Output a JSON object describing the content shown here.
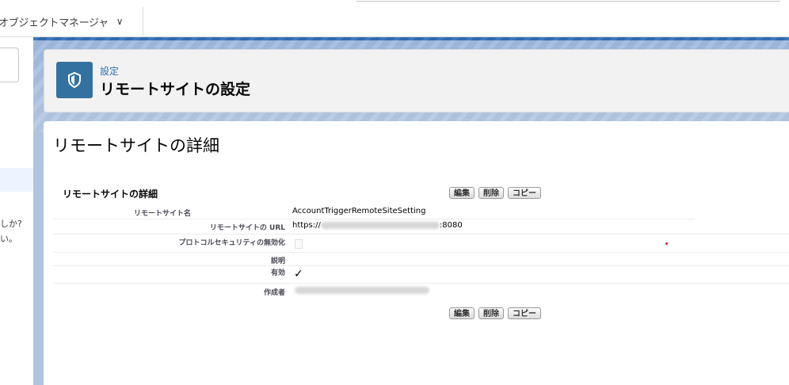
{
  "app": {
    "tab_label": "オブジェクトマネージャ",
    "chevron": "∨"
  },
  "left_panel": {
    "text1": "しか?",
    "text2": "い。"
  },
  "header": {
    "breadcrumb": "設定",
    "title": "リモートサイトの設定",
    "icon": "shield-icon"
  },
  "page": {
    "heading": "リモートサイトの詳細",
    "section_title": "リモートサイトの詳細"
  },
  "buttons": {
    "edit": "編集",
    "delete": "削除",
    "copy": "コピー"
  },
  "fields": {
    "name_label": "リモートサイト名",
    "name_value": "AccountTriggerRemoteSiteSetting",
    "url_label": "リモートサイトの URL",
    "url_prefix": "https://",
    "url_suffix": ":8080",
    "protocol_label": "プロトコルセキュリティの無効化",
    "description_label": "説明",
    "active_label": "有効",
    "active_check": "✓",
    "created_by_label": "作成者"
  },
  "colors": {
    "header_icon_bg": "#3371a0",
    "link": "#2d6fb4",
    "background": "#b0c4df"
  }
}
